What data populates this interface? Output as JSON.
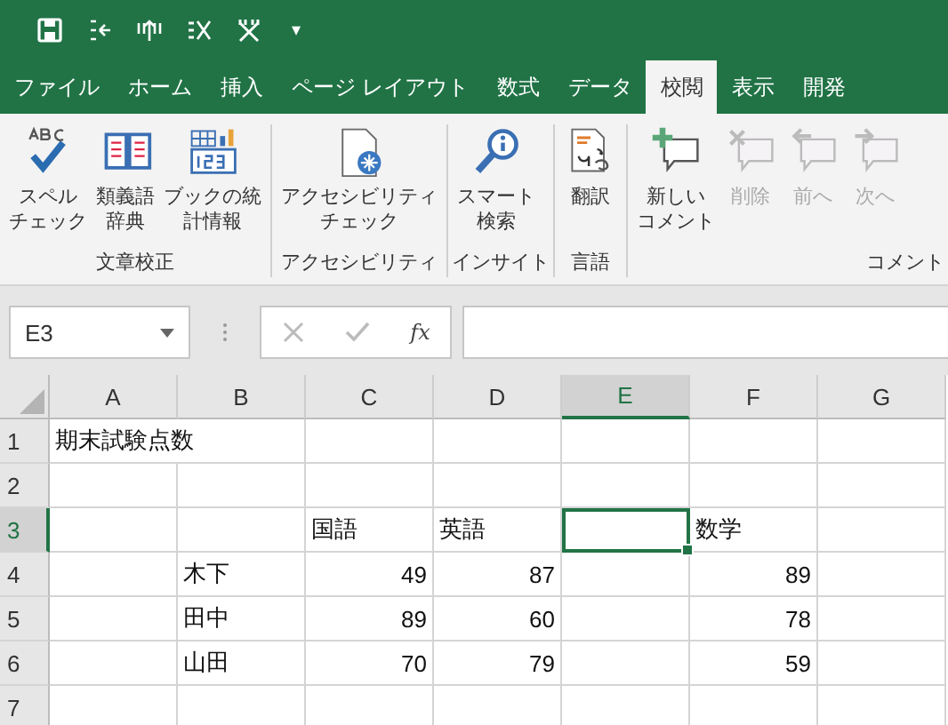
{
  "quick_access": {
    "more": "▾"
  },
  "tabs": [
    {
      "label": "ファイル",
      "selected": false
    },
    {
      "label": "ホーム",
      "selected": false
    },
    {
      "label": "挿入",
      "selected": false
    },
    {
      "label": "ページ レイアウト",
      "selected": false
    },
    {
      "label": "数式",
      "selected": false
    },
    {
      "label": "データ",
      "selected": false
    },
    {
      "label": "校閲",
      "selected": true
    },
    {
      "label": "表示",
      "selected": false
    },
    {
      "label": "開発",
      "selected": false
    }
  ],
  "ribbon_groups": [
    {
      "label": "文章校正",
      "buttons": [
        {
          "lines": [
            "スペル",
            "チェック"
          ],
          "disabled": false
        },
        {
          "lines": [
            "類義語",
            "辞典"
          ],
          "disabled": false
        },
        {
          "lines": [
            "ブックの統",
            "計情報"
          ],
          "disabled": false
        }
      ]
    },
    {
      "label": "アクセシビリティ",
      "buttons": [
        {
          "lines": [
            "アクセシビリティ",
            "チェック"
          ],
          "disabled": false
        }
      ]
    },
    {
      "label": "インサイト",
      "buttons": [
        {
          "lines": [
            "スマート",
            "検索"
          ],
          "disabled": false
        }
      ]
    },
    {
      "label": "言語",
      "buttons": [
        {
          "lines": [
            "翻訳"
          ],
          "disabled": false
        }
      ]
    },
    {
      "label": "コメント",
      "buttons": [
        {
          "lines": [
            "新しい",
            "コメント"
          ],
          "disabled": false
        },
        {
          "lines": [
            "削除"
          ],
          "disabled": true
        },
        {
          "lines": [
            "前へ"
          ],
          "disabled": true
        },
        {
          "lines": [
            "次へ"
          ],
          "disabled": true
        }
      ]
    }
  ],
  "formula_bar": {
    "name_box": "E3",
    "function_button": "fx"
  },
  "sheet": {
    "columns": [
      {
        "label": "A",
        "selected": false
      },
      {
        "label": "B",
        "selected": false
      },
      {
        "label": "C",
        "selected": false
      },
      {
        "label": "D",
        "selected": false
      },
      {
        "label": "E",
        "selected": true
      },
      {
        "label": "F",
        "selected": false
      },
      {
        "label": "G",
        "selected": false
      }
    ],
    "rows": [
      {
        "label": "1",
        "selected": false,
        "cells": [
          {
            "text": "期末試験点数",
            "kind": "text"
          },
          {
            "kind": "empty"
          },
          {
            "kind": "empty"
          },
          {
            "kind": "empty"
          },
          {
            "kind": "empty"
          },
          {
            "kind": "empty"
          },
          {
            "kind": "empty"
          }
        ]
      },
      {
        "label": "2",
        "selected": false,
        "cells": [
          {
            "kind": "empty"
          },
          {
            "kind": "empty"
          },
          {
            "kind": "empty"
          },
          {
            "kind": "empty"
          },
          {
            "kind": "empty"
          },
          {
            "kind": "empty"
          },
          {
            "kind": "empty"
          }
        ]
      },
      {
        "label": "3",
        "selected": true,
        "cells": [
          {
            "kind": "empty"
          },
          {
            "kind": "empty"
          },
          {
            "text": "国語",
            "kind": "text"
          },
          {
            "text": "英語",
            "kind": "text"
          },
          {
            "kind": "empty"
          },
          {
            "text": "数学",
            "kind": "text"
          },
          {
            "kind": "empty"
          }
        ]
      },
      {
        "label": "4",
        "selected": false,
        "cells": [
          {
            "kind": "empty"
          },
          {
            "text": "木下",
            "kind": "text"
          },
          {
            "text": "49",
            "kind": "number"
          },
          {
            "text": "87",
            "kind": "number"
          },
          {
            "kind": "empty"
          },
          {
            "text": "89",
            "kind": "number"
          },
          {
            "kind": "empty"
          }
        ]
      },
      {
        "label": "5",
        "selected": false,
        "cells": [
          {
            "kind": "empty"
          },
          {
            "text": "田中",
            "kind": "text"
          },
          {
            "text": "89",
            "kind": "number"
          },
          {
            "text": "60",
            "kind": "number"
          },
          {
            "kind": "empty"
          },
          {
            "text": "78",
            "kind": "number"
          },
          {
            "kind": "empty"
          }
        ]
      },
      {
        "label": "6",
        "selected": false,
        "cells": [
          {
            "kind": "empty"
          },
          {
            "text": "山田",
            "kind": "text"
          },
          {
            "text": "70",
            "kind": "number"
          },
          {
            "text": "79",
            "kind": "number"
          },
          {
            "kind": "empty"
          },
          {
            "text": "59",
            "kind": "number"
          },
          {
            "kind": "empty"
          }
        ]
      },
      {
        "label": "7",
        "selected": false,
        "cells": [
          {
            "kind": "empty"
          },
          {
            "kind": "empty"
          },
          {
            "kind": "empty"
          },
          {
            "kind": "empty"
          },
          {
            "kind": "empty"
          },
          {
            "kind": "empty"
          },
          {
            "kind": "empty"
          }
        ]
      }
    ]
  }
}
